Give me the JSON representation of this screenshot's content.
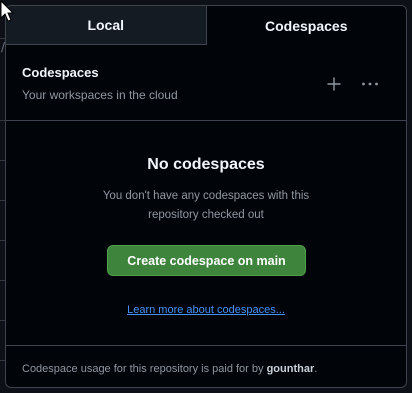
{
  "tabs": [
    {
      "label": "Local",
      "active": false
    },
    {
      "label": "Codespaces",
      "active": true
    }
  ],
  "header": {
    "title": "Codespaces",
    "subtitle": "Your workspaces in the cloud",
    "icons": [
      "plus-icon",
      "kebab-horizontal-icon"
    ]
  },
  "empty_state": {
    "title": "No codespaces",
    "description": "You don't have any codespaces with this repository checked out",
    "create_button": "Create codespace on main",
    "learn_more": "Learn more about codespaces..."
  },
  "footer": {
    "prefix": "Codespace usage for this repository is paid for by ",
    "user": "gounthar",
    "suffix": "."
  },
  "colors": {
    "panel_bg": "#010409",
    "border": "#3d444d",
    "text_primary": "#f0f6fc",
    "text_muted": "#9198a1",
    "primary_button": "#3f843d",
    "link": "#4493f8"
  }
}
